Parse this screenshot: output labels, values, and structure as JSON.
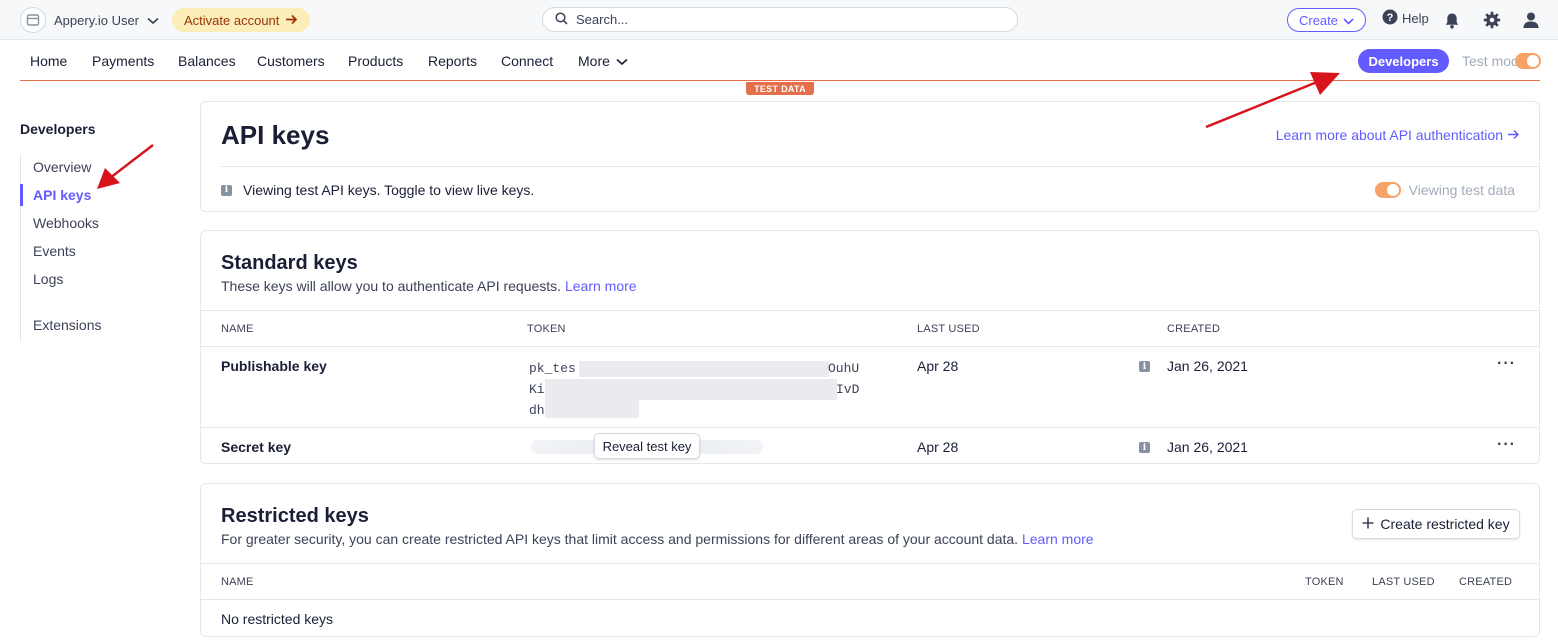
{
  "topbar": {
    "account_name": "Appery.io User",
    "activate_label": "Activate account",
    "search_placeholder": "Search...",
    "create_label": "Create",
    "help_label": "Help"
  },
  "nav": {
    "items": [
      "Home",
      "Payments",
      "Balances",
      "Customers",
      "Products",
      "Reports",
      "Connect",
      "More"
    ],
    "developers_label": "Developers",
    "test_mode_label": "Test mode",
    "test_data_badge": "TEST DATA"
  },
  "sidebar": {
    "title": "Developers",
    "items": [
      "Overview",
      "API keys",
      "Webhooks",
      "Events",
      "Logs",
      "Extensions"
    ],
    "active_index": 1
  },
  "api_keys": {
    "title": "API keys",
    "learn_link": "Learn more about API authentication",
    "info_text": "Viewing test API keys. Toggle to view live keys.",
    "viewing_label": "Viewing test data"
  },
  "standard_keys": {
    "title": "Standard keys",
    "description": "These keys will allow you to authenticate API requests.",
    "learn_more": "Learn more",
    "columns": [
      "NAME",
      "TOKEN",
      "LAST USED",
      "CREATED"
    ],
    "rows": [
      {
        "name": "Publishable key",
        "token_lines": [
          "pk_tes",
          "Ki",
          "dh"
        ],
        "token_line_ends": [
          "OuhU",
          "IvD",
          ""
        ],
        "last_used": "Apr 28",
        "created": "Jan 26, 2021"
      },
      {
        "name": "Secret key",
        "reveal_label": "Reveal test key",
        "last_used": "Apr 28",
        "created": "Jan 26, 2021"
      }
    ]
  },
  "restricted_keys": {
    "title": "Restricted keys",
    "description": "For greater security, you can create restricted API keys that limit access and permissions for different areas of your account data.",
    "learn_more": "Learn more",
    "create_label": "Create restricted key",
    "columns": [
      "NAME",
      "TOKEN",
      "LAST USED",
      "CREATED"
    ],
    "empty_text": "No restricted keys"
  },
  "colors": {
    "accent": "#635bff",
    "test_orange": "#e56f4a",
    "annotation_red": "#d8141b"
  }
}
